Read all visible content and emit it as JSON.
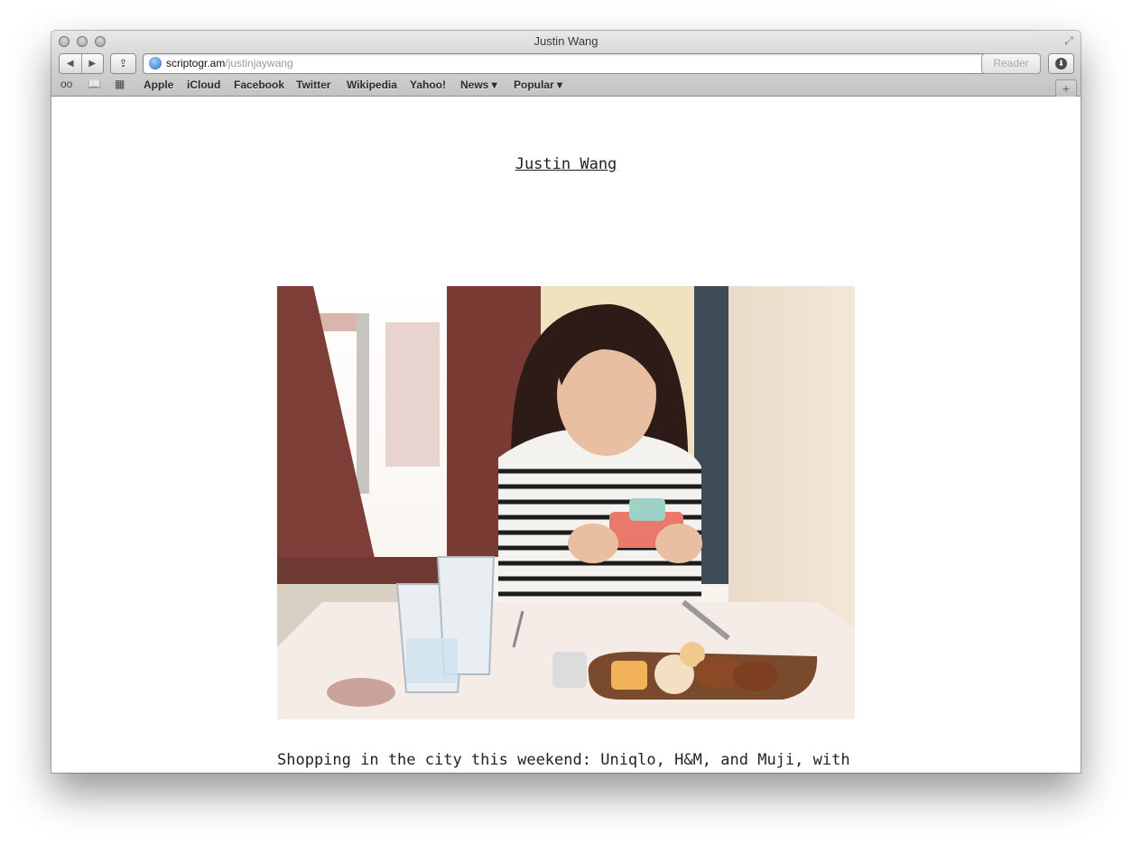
{
  "window": {
    "title": "Justin Wang"
  },
  "toolbar": {
    "back_icon": "◀",
    "forward_icon": "▶",
    "share_icon": "⇪",
    "reload_icon": "↻",
    "reader_label": "Reader",
    "download_icon": "⬇"
  },
  "address_bar": {
    "domain": "scriptogr.am",
    "path": "/justinjaywang"
  },
  "bookmarks_bar": {
    "items": [
      "Apple",
      "iCloud",
      "Facebook",
      "Twitter",
      "Wikipedia",
      "Yahoo!",
      "News ▾",
      "Popular ▾"
    ]
  },
  "page": {
    "site_title": "Justin Wang",
    "post_text": "Shopping in the city this weekend: Uniqlo, H&M, and Muji, with"
  }
}
